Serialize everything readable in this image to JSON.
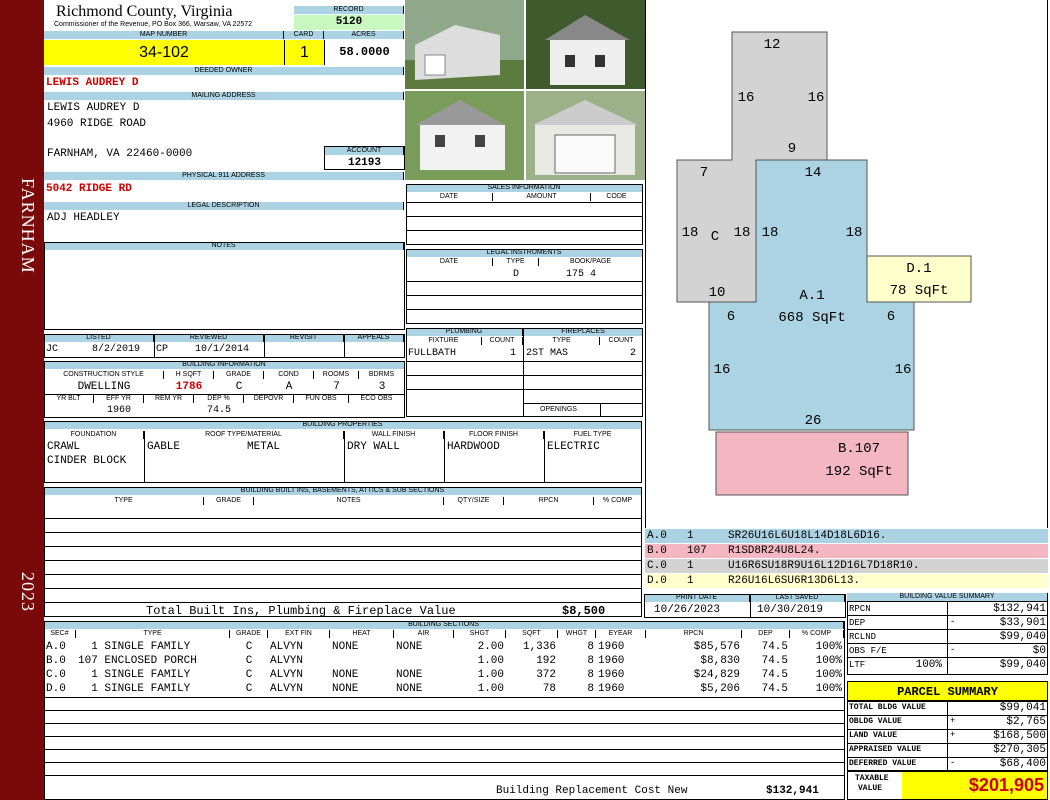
{
  "sidebar": {
    "city": "FARNHAM",
    "year": "2023"
  },
  "header": {
    "county": "Richmond County, Virginia",
    "commissioner": "Commissioner of the Revenue, PO Box 366, Warsaw, VA 22572",
    "record_label": "RECORD",
    "record": "5120"
  },
  "parcel": {
    "map_label": "MAP NUMBER",
    "map": "34-102",
    "card_label": "CARD",
    "card": "1",
    "acres_label": "ACRES",
    "acres": "58.0000"
  },
  "owner": {
    "deeded_label": "DEEDED OWNER",
    "deeded": "LEWIS AUDREY D",
    "mailing_label": "MAILING ADDRESS",
    "mail1": "LEWIS AUDREY D",
    "mail2": "4960 RIDGE ROAD",
    "mail3": "FARNHAM, VA 22460-0000",
    "account_label": "ACCOUNT",
    "account": "12193"
  },
  "address": {
    "label": "PHYSICAL 911 ADDRESS",
    "value": "5042 RIDGE RD"
  },
  "legal": {
    "label": "LEGAL DESCRIPTION",
    "value": "ADJ HEADLEY"
  },
  "notes": {
    "label": "NOTES"
  },
  "sales": {
    "label": "SALES INFORMATION",
    "cols": [
      "DATE",
      "AMOUNT",
      "CODE"
    ]
  },
  "instruments": {
    "label": "LEGAL INSTRUMENTS",
    "cols": [
      "DATE",
      "TYPE",
      "BOOK/PAGE"
    ],
    "type": "D",
    "book": "175 4"
  },
  "plumbing": {
    "label": "PLUMBING",
    "cols": [
      "FIXTURE",
      "COUNT"
    ],
    "fixture": "FULLBATH",
    "count": "1"
  },
  "fireplaces": {
    "label": "FIREPLACES",
    "cols": [
      "TYPE",
      "COUNT"
    ],
    "type": "2ST MAS",
    "count": "2",
    "openings_label": "OPENINGS"
  },
  "review": {
    "listed_label": "LISTED",
    "listed_by": "JC",
    "listed_date": "8/2/2019",
    "reviewed_label": "REVIEWED",
    "reviewed_by": "CP",
    "reviewed_date": "10/1/2014",
    "revisit_label": "REVISIT",
    "appeals_label": "APPEALS"
  },
  "building_info": {
    "label": "BUILDING INFORMATION",
    "cols": [
      "CONSTRUCTION STYLE",
      "H SQFT",
      "GRADE",
      "COND",
      "ROOMS",
      "BDRMS"
    ],
    "style": "DWELLING",
    "hsqft": "1786",
    "grade": "C",
    "cond": "A",
    "rooms": "7",
    "bdrms": "3",
    "cols2": [
      "YR BLT",
      "EFF YR",
      "REM YR",
      "DEP %",
      "DEPOVR",
      "FUN OBS",
      "ECO OBS"
    ],
    "eff_yr": "1960",
    "dep": "74.5"
  },
  "properties": {
    "label": "BUILDING PROPERTIES",
    "cols": [
      "FOUNDATION",
      "ROOF TYPE/MATERIAL",
      "WALL FINISH",
      "FLOOR FINISH",
      "FUEL TYPE"
    ],
    "foundation1": "CRAWL",
    "foundation2": "CINDER BLOCK",
    "roof_type": "GABLE",
    "roof_mat": "METAL",
    "wall": "DRY WALL",
    "floor": "HARDWOOD",
    "fuel": "ELECTRIC"
  },
  "builtins": {
    "label": "BUILDING BUILT INS, BASEMENTS, ATTICS & SUB SECTIONS",
    "cols": [
      "TYPE",
      "GRADE",
      "NOTES",
      "QTY/SIZE",
      "RPCN",
      "% COMP"
    ],
    "total_label": "Total Built Ins, Plumbing & Fireplace Value",
    "total": "$8,500"
  },
  "dates": {
    "print_label": "PRINT DATE",
    "print": "10/26/2023",
    "saved_label": "LAST SAVED",
    "saved": "10/30/2019"
  },
  "sections": {
    "label": "BUILDING SECTIONS",
    "cols": [
      "SEC#",
      "TYPE",
      "GRADE",
      "EXT FIN",
      "HEAT",
      "AIR",
      "SHGT",
      "SQFT",
      "WHGT",
      "EYEAR",
      "RPCN",
      "DEP",
      "% COMP"
    ],
    "rows": [
      {
        "sec": "A.0",
        "num": "1",
        "type": "SINGLE FAMILY",
        "grade": "C",
        "ext": "ALVYN",
        "heat": "NONE",
        "air": "NONE",
        "shgt": "2.00",
        "sqft": "1,336",
        "whgt": "8",
        "eyear": "1960",
        "rpcn": "$85,576",
        "dep": "74.5",
        "comp": "100%"
      },
      {
        "sec": "B.0",
        "num": "107",
        "type": "ENCLOSED PORCH",
        "grade": "C",
        "ext": "ALVYN",
        "heat": "",
        "air": "",
        "shgt": "1.00",
        "sqft": "192",
        "whgt": "8",
        "eyear": "1960",
        "rpcn": "$8,830",
        "dep": "74.5",
        "comp": "100%"
      },
      {
        "sec": "C.0",
        "num": "1",
        "type": "SINGLE FAMILY",
        "grade": "C",
        "ext": "ALVYN",
        "heat": "NONE",
        "air": "NONE",
        "shgt": "1.00",
        "sqft": "372",
        "whgt": "8",
        "eyear": "1960",
        "rpcn": "$24,829",
        "dep": "74.5",
        "comp": "100%"
      },
      {
        "sec": "D.0",
        "num": "1",
        "type": "SINGLE FAMILY",
        "grade": "C",
        "ext": "ALVYN",
        "heat": "NONE",
        "air": "NONE",
        "shgt": "1.00",
        "sqft": "78",
        "whgt": "8",
        "eyear": "1960",
        "rpcn": "$5,206",
        "dep": "74.5",
        "comp": "100%"
      }
    ],
    "brcn_label": "Building Replacement Cost New",
    "brcn": "$132,941"
  },
  "sketch": {
    "a_label": "A.1",
    "a_sqft": "668 SqFt",
    "b_label": "B.107",
    "b_sqft": "192 SqFt",
    "d_label": "D.1",
    "d_sqft": "78 SqFt",
    "c_label": "C",
    "dims": [
      "12",
      "16",
      "16",
      "9",
      "7",
      "14",
      "18",
      "18",
      "18",
      "18",
      "10",
      "6",
      "6",
      "16",
      "16",
      "26"
    ],
    "colors": {
      "a": "#acd3e3",
      "b": "#f4b6c2",
      "c": "#d3d3d3",
      "d": "#ffffcc"
    }
  },
  "legend": [
    {
      "sec": "A.0",
      "num": "1",
      "code": "SR26U16L6U18L14D18L6D16.",
      "color": "#acd3e3"
    },
    {
      "sec": "B.0",
      "num": "107",
      "code": "R1SD8R24U8L24.",
      "color": "#f4b6c2"
    },
    {
      "sec": "C.0",
      "num": "1",
      "code": "U16R6SU18R9U16L12D16L7D18R10.",
      "color": "#d3d3d3"
    },
    {
      "sec": "D.0",
      "num": "1",
      "code": "R26U16L6SU6R13D6L13.",
      "color": "#ffffcc"
    }
  ],
  "bvs": {
    "label": "BUILDING VALUE SUMMARY",
    "rpcn_label": "RPCN",
    "rpcn": "$132,941",
    "dep_label": "DEP",
    "dep_sign": "-",
    "dep": "$33,901",
    "rclnd_label": "RCLND",
    "rclnd": "$99,040",
    "obs_label": "OBS F/E",
    "obs_sign": "-",
    "obs": "$0",
    "ltf_label": "LTF",
    "ltf_pct": "100%",
    "ltf": "$99,040"
  },
  "summary": {
    "title": "PARCEL SUMMARY",
    "bldg_label": "TOTAL BLDG VALUE",
    "bldg": "$99,041",
    "obldg_label": "OBLDG VALUE",
    "obldg_sign": "+",
    "obldg": "$2,765",
    "land_label": "LAND VALUE",
    "land_sign": "+",
    "land": "$168,500",
    "appraised_label": "APPRAISED VALUE",
    "appraised": "$270,305",
    "deferred_label": "DEFERRED VALUE",
    "deferred_sign": "-",
    "deferred": "$68,400",
    "taxable_label1": "TAXABLE",
    "taxable_label2": "VALUE",
    "taxable": "$201,905"
  }
}
